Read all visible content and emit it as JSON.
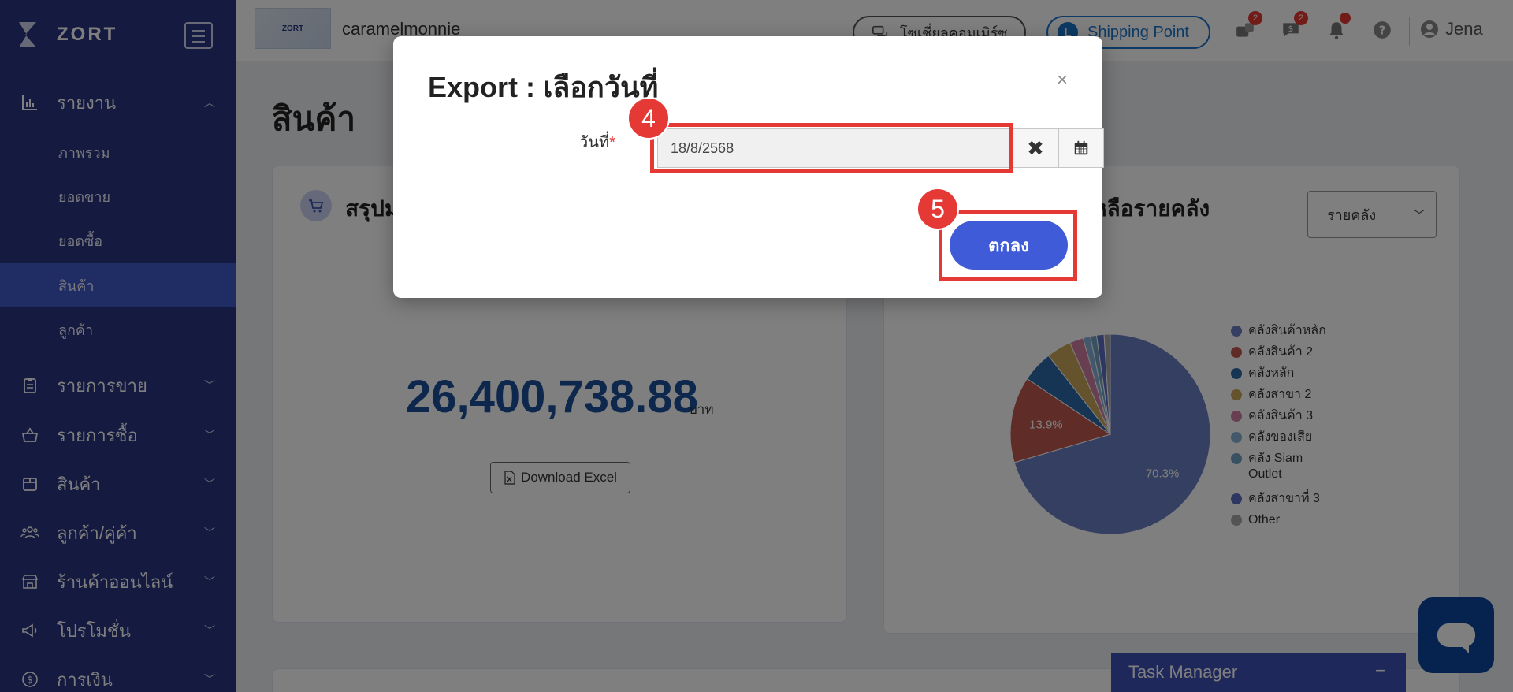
{
  "brand": {
    "name": "ZORT"
  },
  "sidebar": {
    "reports": {
      "label": "รายงาน",
      "subitems": [
        "ภาพรวม",
        "ยอดขาย",
        "ยอดซื้อ",
        "สินค้า",
        "ลูกค้า"
      ]
    },
    "sections": [
      "รายการขาย",
      "รายการซื้อ",
      "สินค้า",
      "ลูกค้า/คู่ค้า",
      "ร้านค้าออนไลน์",
      "โปรโมชั่น",
      "การเงิน"
    ]
  },
  "topbar": {
    "shop_logo_text": "ZORT",
    "shop_name": "caramelmonnie",
    "chat_commerce_label": "โซเชี่ยลคอมเมิร์ซ",
    "shipping_point_label": "Shipping Point",
    "orders_badge": "2",
    "messages_badge": "2",
    "user_name": "Jena"
  },
  "page": {
    "title": "สินค้า"
  },
  "summary_card": {
    "title": "สรุปม",
    "value": "26,400,738.88",
    "unit": "บาท",
    "download_label": "Download Excel"
  },
  "warehouse_card": {
    "title": "หลือรายคลัง",
    "select_value": "รายคลัง"
  },
  "chart_data": {
    "type": "pie",
    "slices": [
      {
        "name": "คลังสินค้าหลัก",
        "value": 70.3,
        "color": "#6a7fc4"
      },
      {
        "name": "คลังสินค้า 2",
        "value": 13.9,
        "color": "#c0584f"
      },
      {
        "name": "คลังหลัก",
        "value": 5.0,
        "color": "#2d6aa8"
      },
      {
        "name": "คลังสาขา 2",
        "value": 4.0,
        "color": "#c9a65a"
      },
      {
        "name": "คลังสินค้า 3",
        "value": 2.2,
        "color": "#cf7fa0"
      },
      {
        "name": "คลังของเสีย",
        "value": 1.2,
        "color": "#87b2d6"
      },
      {
        "name": "คลัง Siam Outlet",
        "value": 1.0,
        "color": "#6ea3c4"
      },
      {
        "name": "คลังสาขาที่ 3",
        "value": 1.2,
        "color": "#5a6fc2"
      },
      {
        "name": "Other",
        "value": 1.0,
        "color": "#a9a9a9"
      }
    ],
    "labels_shown": [
      "70.3%",
      "13.9%"
    ]
  },
  "modal": {
    "title": "Export : เลือกวันที่",
    "close": "×",
    "date_label": "วันที่",
    "required_mark": "*",
    "date_value": "18/8/2568",
    "clear_icon": "✖",
    "ok_label": "ตกลง",
    "step_date": "4",
    "step_ok": "5"
  },
  "task_manager": {
    "label": "Task Manager",
    "minimize": "−"
  }
}
